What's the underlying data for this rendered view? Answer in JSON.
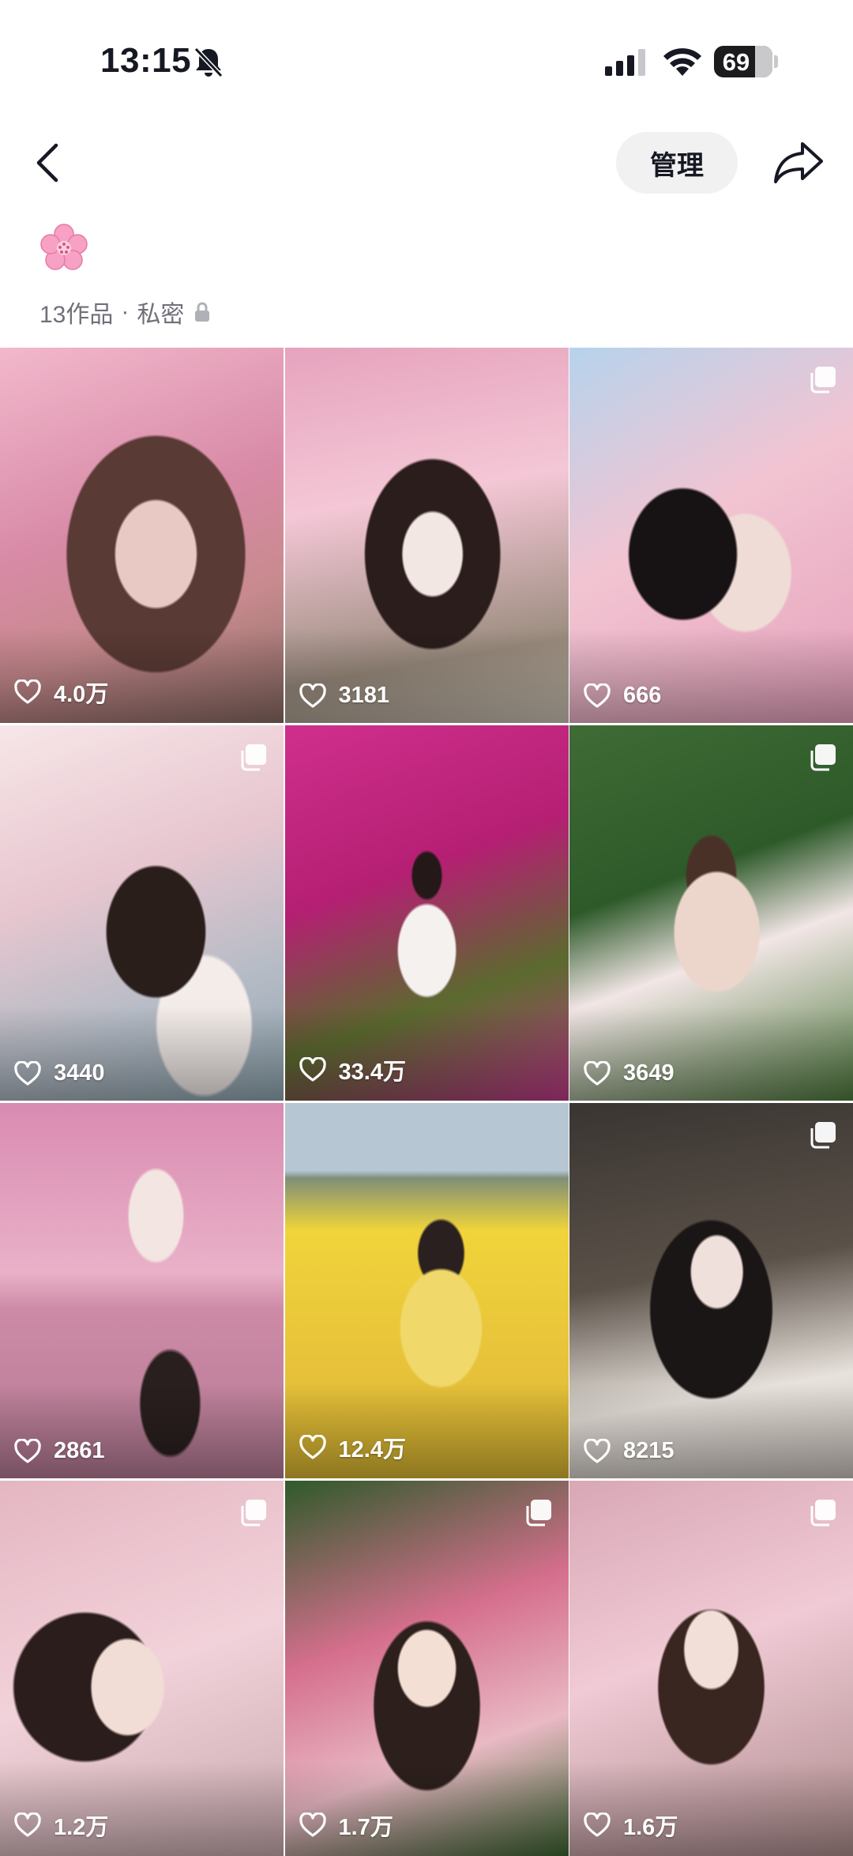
{
  "status_bar": {
    "time": "13:15",
    "battery": "69",
    "battery_level": 0.69
  },
  "header": {
    "manage_label": "管理"
  },
  "collection": {
    "count_label": "13作品",
    "separator": "·",
    "privacy_label": "私密"
  },
  "videos": [
    {
      "likes": "4.0万",
      "multi": false
    },
    {
      "likes": "3181",
      "multi": false
    },
    {
      "likes": "666",
      "multi": true
    },
    {
      "likes": "3440",
      "multi": true
    },
    {
      "likes": "33.4万",
      "multi": false
    },
    {
      "likes": "3649",
      "multi": true
    },
    {
      "likes": "2861",
      "multi": false
    },
    {
      "likes": "12.4万",
      "multi": false
    },
    {
      "likes": "8215",
      "multi": true
    },
    {
      "likes": "1.2万",
      "multi": true
    },
    {
      "likes": "1.7万",
      "multi": true
    },
    {
      "likes": "1.6万",
      "multi": true
    }
  ],
  "colors": {
    "text_primary": "#161823",
    "text_secondary": "#6f7079",
    "manage_bg": "#f1f1f2"
  }
}
